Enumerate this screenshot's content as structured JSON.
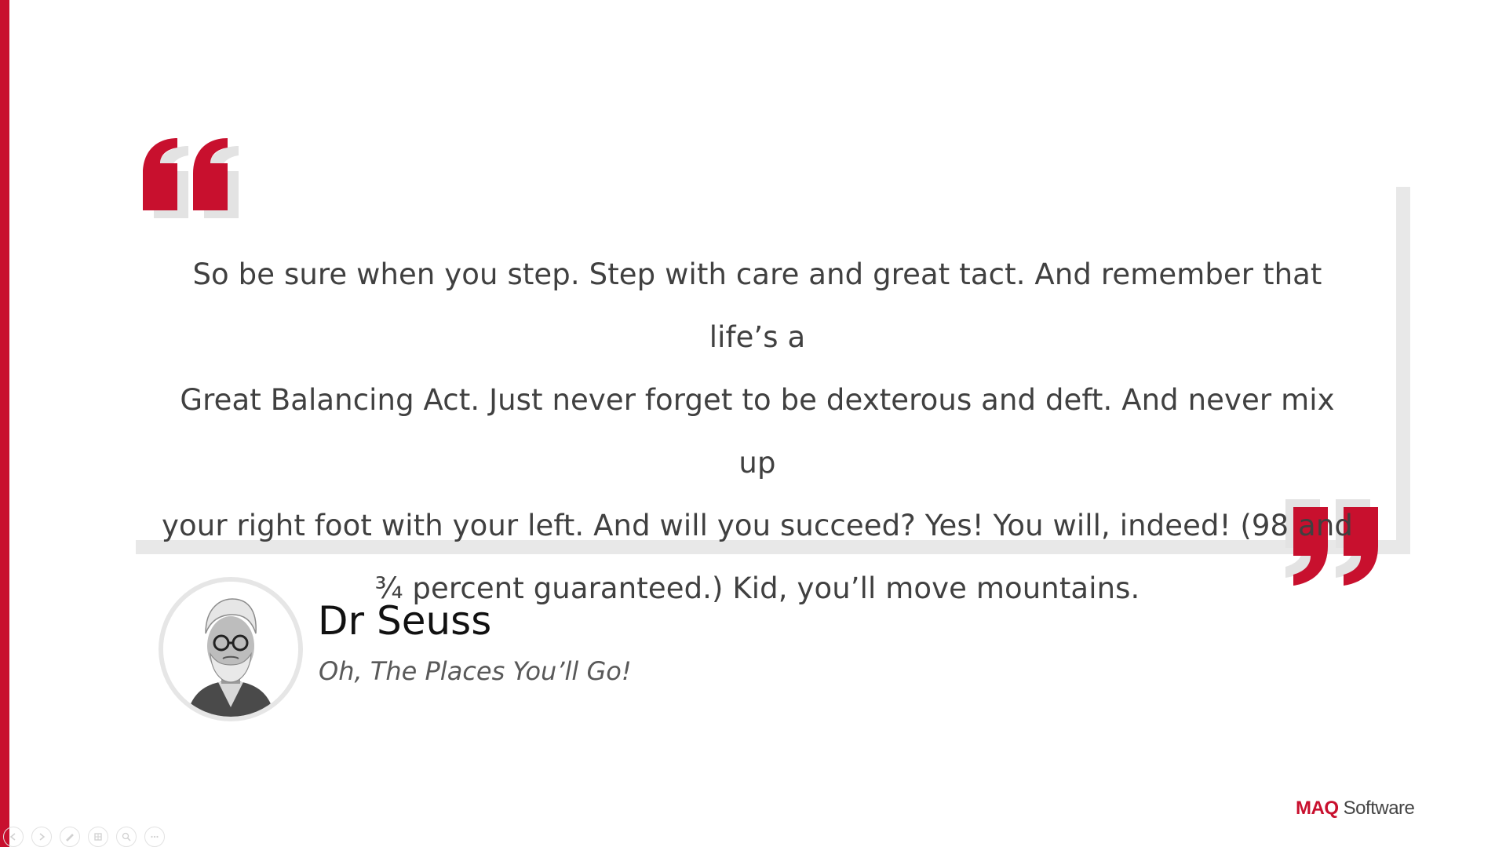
{
  "quote": {
    "lines": [
      "So be sure when you step. Step with care and great tact. And remember that life’s a",
      "Great Balancing Act. Just never forget to be dexterous and deft. And never mix up",
      "your right foot with your left. And will you succeed? Yes! You will, indeed! (98 and",
      "¾ percent guaranteed.) Kid, you’ll move mountains."
    ]
  },
  "author": {
    "name": "Dr Seuss",
    "work": "Oh, The Places You’ll Go!"
  },
  "logo": {
    "brand": "MAQ",
    "suffix": " Software"
  },
  "controls": [
    {
      "name": "previous-slide-icon"
    },
    {
      "name": "next-slide-icon"
    },
    {
      "name": "pen-icon"
    },
    {
      "name": "slides-grid-icon"
    },
    {
      "name": "zoom-icon"
    },
    {
      "name": "more-options-icon"
    }
  ],
  "colors": {
    "accent": "#c8102e",
    "frame": "#e8e8e8",
    "text": "#404040"
  }
}
